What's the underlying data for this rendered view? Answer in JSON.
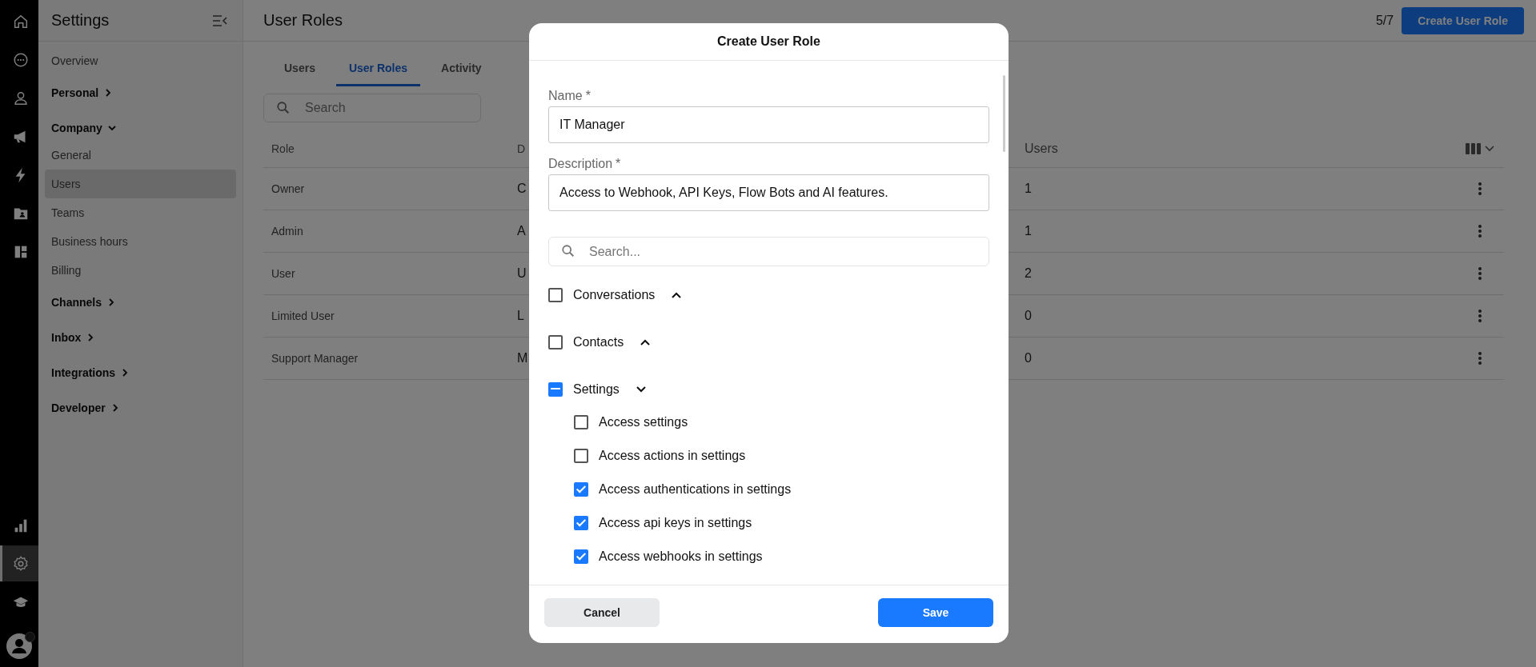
{
  "rail": {
    "top": [
      {
        "kind": "home",
        "selected": false
      },
      {
        "kind": "chat",
        "selected": false
      },
      {
        "kind": "person",
        "selected": false
      },
      {
        "kind": "megaphone",
        "selected": false
      },
      {
        "kind": "bolt",
        "selected": false
      },
      {
        "kind": "contact-folder",
        "selected": false
      },
      {
        "kind": "dashboard",
        "selected": false
      }
    ],
    "bottom": [
      {
        "kind": "bar-chart",
        "selected": false
      },
      {
        "kind": "gear",
        "selected": true
      },
      {
        "kind": "graduation-cap",
        "selected": false
      }
    ],
    "avatar": {
      "online": true
    }
  },
  "sidebar": {
    "title": "Settings",
    "items": [
      {
        "kind": "link",
        "label": "Overview",
        "selected": false
      },
      {
        "kind": "group",
        "label": "Personal",
        "expanded": false
      },
      {
        "kind": "group",
        "label": "Company",
        "expanded": true
      },
      {
        "kind": "link",
        "label": "General",
        "selected": false
      },
      {
        "kind": "link",
        "label": "Users",
        "selected": true
      },
      {
        "kind": "link",
        "label": "Teams",
        "selected": false
      },
      {
        "kind": "link",
        "label": "Business hours",
        "selected": false
      },
      {
        "kind": "link",
        "label": "Billing",
        "selected": false
      },
      {
        "kind": "group",
        "label": "Channels",
        "expanded": false
      },
      {
        "kind": "group",
        "label": "Inbox",
        "expanded": false
      },
      {
        "kind": "group",
        "label": "Integrations",
        "expanded": false
      },
      {
        "kind": "group",
        "label": "Developer",
        "expanded": false
      }
    ]
  },
  "page": {
    "title": "User Roles",
    "count": "5/7",
    "create_button": "Create User Role",
    "tabs": [
      {
        "label": "Users",
        "selected": false
      },
      {
        "label": "User Roles",
        "selected": true
      },
      {
        "label": "Activity",
        "selected": false
      }
    ],
    "search": {
      "placeholder": "Search"
    },
    "table": {
      "columns": [
        "Role",
        "D",
        "Users"
      ],
      "rows": [
        {
          "cells": [
            "Owner",
            "C",
            "1"
          ]
        },
        {
          "cells": [
            "Admin",
            "A",
            "1"
          ]
        },
        {
          "cells": [
            "User",
            "U",
            "2"
          ]
        },
        {
          "cells": [
            "Limited User",
            "L",
            "0"
          ]
        },
        {
          "cells": [
            "Support Manager",
            "M",
            "0"
          ]
        }
      ]
    }
  },
  "dialog": {
    "title": "Create User Role",
    "fields": [
      {
        "label": "Name",
        "required_mark": "*",
        "value": "IT Manager"
      },
      {
        "label": "Description",
        "required_mark": "*",
        "value": "Access to Webhook, API Keys, Flow Bots and AI features."
      }
    ],
    "search": {
      "placeholder": "Search..."
    },
    "groups": [
      {
        "label": "Conversations",
        "checked": false,
        "indeterminate": false,
        "expanded": false
      },
      {
        "label": "Contacts",
        "checked": false,
        "indeterminate": false,
        "expanded": false
      },
      {
        "label": "Settings",
        "checked": true,
        "indeterminate": true,
        "expanded": true,
        "children": [
          {
            "label": "Access settings",
            "checked": false
          },
          {
            "label": "Access actions in settings",
            "checked": false
          },
          {
            "label": "Access authentications in settings",
            "checked": true
          },
          {
            "label": "Access api keys in settings",
            "checked": true
          },
          {
            "label": "Access webhooks in settings",
            "checked": true
          }
        ]
      }
    ],
    "cancel_button": "Cancel",
    "save_button": "Save"
  }
}
